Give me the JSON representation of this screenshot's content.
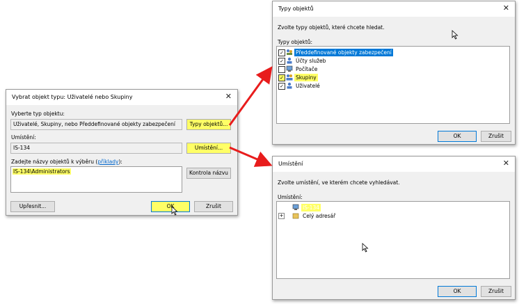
{
  "dialog_main": {
    "title": "Vybrat objekt typu: Uživatelé nebo Skupiny",
    "object_type_label": "Vyberte typ objektu:",
    "object_type_value": "Uživatelé, Skupiny, nebo Předdefinované objekty zabezpečení",
    "object_types_button": "Typy objektů...",
    "location_label": "Umístění:",
    "location_value": "IS-134",
    "locations_button": "Umístění...",
    "names_label_prefix": "Zadejte názvy objektů k výběru (",
    "names_label_link": "příklady",
    "names_label_suffix": "):",
    "names_value": "IS-134\\Administrators",
    "check_names_button": "Kontrola názvu",
    "advanced_button": "Upřesnit...",
    "ok_button": "OK",
    "cancel_button": "Zrušit"
  },
  "dialog_types": {
    "title": "Typy objektů",
    "instruction": "Zvolte typy objektů, které chcete hledat.",
    "list_label": "Typy objektů:",
    "items": [
      {
        "label": "Předdefinované objekty zabezpečení",
        "checked": true,
        "selected": true
      },
      {
        "label": "Účty služeb",
        "checked": true
      },
      {
        "label": "Počítače",
        "checked": false
      },
      {
        "label": "Skupiny",
        "checked": true,
        "highlighted": true
      },
      {
        "label": "Uživatelé",
        "checked": true
      }
    ],
    "ok_button": "OK",
    "cancel_button": "Zrušit"
  },
  "dialog_locations": {
    "title": "Umístění",
    "instruction": "Zvolte umístění, ve kterém chcete vyhledávat.",
    "tree_label": "Umístění:",
    "tree_items": [
      {
        "label": "IS-134",
        "selected": true
      },
      {
        "label": "Celý adresář"
      }
    ],
    "ok_button": "OK",
    "cancel_button": "Zrušit"
  },
  "colors": {
    "highlight": "#ffff66",
    "arrow": "#e81c1c",
    "selection": "#0078d7"
  }
}
